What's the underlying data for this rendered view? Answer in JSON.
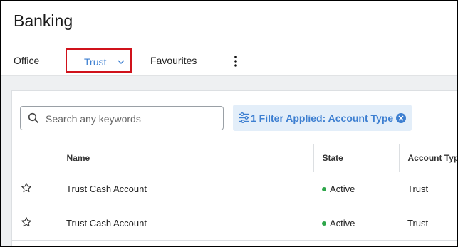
{
  "page": {
    "title": "Banking"
  },
  "tabs": {
    "office": "Office",
    "trust": "Trust",
    "favourites": "Favourites"
  },
  "toolbar": {
    "search_placeholder": "Search any keywords",
    "filter_chip_label": "1 Filter Applied: Account Type"
  },
  "table": {
    "columns": [
      "",
      "Name",
      "State",
      "Account Type"
    ],
    "rows": [
      {
        "name": "Trust Cash Account",
        "state": "Active",
        "account_type": "Trust"
      },
      {
        "name": "Trust Cash Account",
        "state": "Active",
        "account_type": "Trust"
      }
    ]
  },
  "colors": {
    "accent": "#3d7fd1",
    "active_dot": "#2ea64a",
    "highlight_border": "#d0121b",
    "chip_bg": "#e3eef9"
  },
  "icons": {
    "tab_chevron": "chevron-down-icon",
    "more": "more-vertical-icon",
    "search": "search-icon",
    "filter": "filter-sliders-icon",
    "clear_filter": "close-circle-icon",
    "favourite": "star-outline-icon"
  }
}
